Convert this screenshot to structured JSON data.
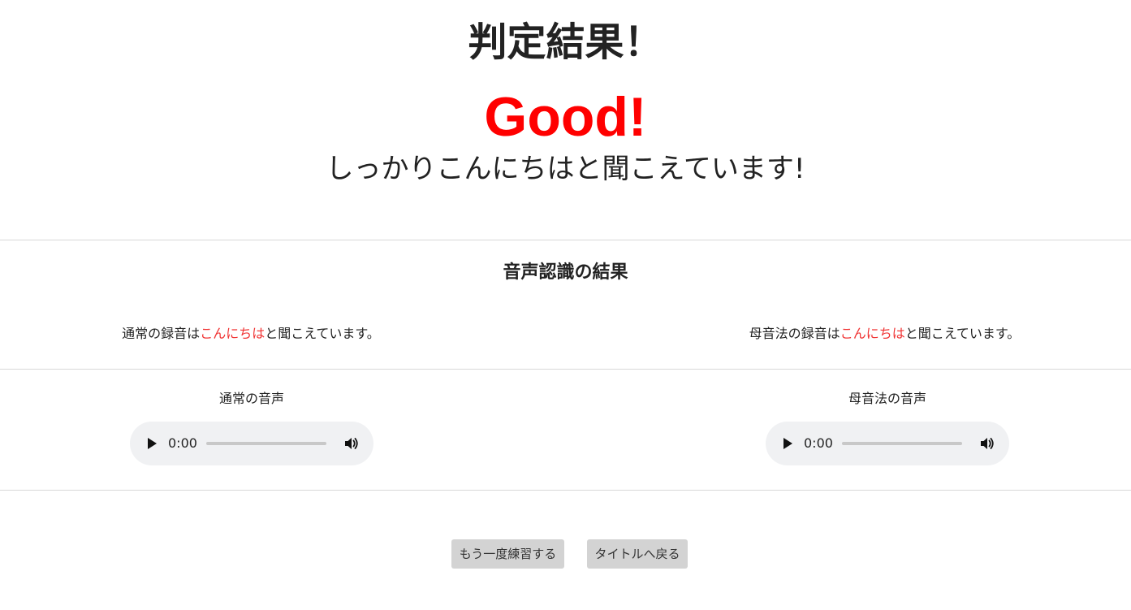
{
  "header": {
    "title": "判定結果！",
    "verdict": "Good!",
    "verdict_message": "しっかりこんにちはと聞こえています!"
  },
  "recognition": {
    "section_title": "音声認識の結果",
    "normal": {
      "prefix": "通常の録音は",
      "word": "こんにちは",
      "suffix": "と聞こえています。"
    },
    "vowel": {
      "prefix": "母音法の録音は",
      "word": "こんにちは",
      "suffix": "と聞こえています。"
    }
  },
  "audio": {
    "normal": {
      "label": "通常の音声",
      "time": "0:00"
    },
    "vowel": {
      "label": "母音法の音声",
      "time": "0:00"
    }
  },
  "actions": {
    "retry_label": "もう一度練習する",
    "back_label": "タイトルへ戻る"
  },
  "colors": {
    "verdict": "#ff0000",
    "highlight": "#f03434",
    "player_bg": "#f0f1f3",
    "button_bg": "#d3d3d3"
  },
  "icons": {
    "play": "play-icon",
    "volume": "volume-icon"
  }
}
